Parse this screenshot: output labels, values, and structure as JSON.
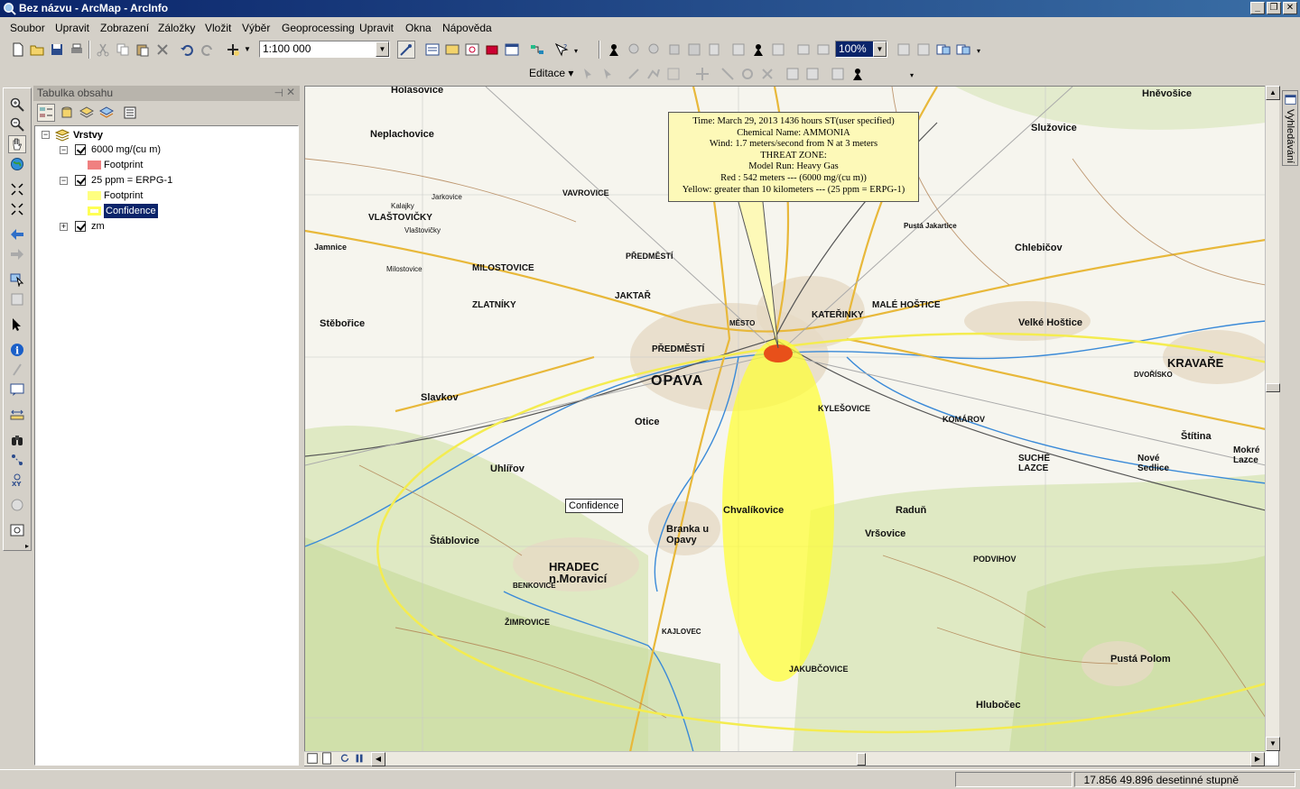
{
  "window": {
    "title": "Bez názvu - ArcMap - ArcInfo"
  },
  "menu": {
    "items": [
      "Soubor",
      "Upravit",
      "Zobrazení",
      "Záložky",
      "Vložit",
      "Výběr",
      "Geoprocessing",
      "Upravit",
      "Okna",
      "Nápověda"
    ]
  },
  "toolbar": {
    "scale_value": "1:100 000",
    "zoom_value": "100%",
    "editor_label": "Editace ▾"
  },
  "toc": {
    "title": "Tabulka obsahu",
    "root": "Vrstvy",
    "layers": [
      {
        "name": "6000 mg/(cu m)",
        "child": "Footprint",
        "color": "#f08080"
      },
      {
        "name": "25 ppm = ERPG-1",
        "children": [
          "Footprint",
          "Confidence"
        ],
        "colors": [
          "#ffff80",
          "#ffff66"
        ]
      },
      {
        "name": "zm"
      }
    ]
  },
  "map": {
    "callout_lines": [
      "Time: March 29, 2013  1436 hours ST(user specified)",
      "Chemical Name: AMMONIA",
      "Wind: 1.7 meters/second from N at 3 meters",
      "THREAT ZONE:",
      "Model Run: Heavy Gas",
      "Red   : 542 meters --- (6000 mg/(cu m))",
      "Yellow: greater than 10 kilometers --- (25 ppm = ERPG-1)"
    ],
    "confidence_label": "Confidence",
    "place_labels": [
      "Holasovice",
      "Neplachovice",
      "VAVROVICE",
      "Jamnice",
      "VLAŠTOVIČKY",
      "MILOSTOVICE",
      "PŘEDMĚSTÍ",
      "ZLATNÍKY",
      "JAKTAŘ",
      "MĚSTO",
      "PŘEDMĚSTÍ",
      "OPAVA",
      "Stěbořice",
      "Slavkov",
      "Otice",
      "KATEŘINKY",
      "MALÉ HOŠTICE",
      "Velké Hoštice",
      "KYLEŠOVICE",
      "KOMÁROV",
      "KRAVAŘE",
      "Chlebičov",
      "Služovice",
      "Hněvošice",
      "Uhlířov",
      "Štáblovice",
      "Branka u Opavy",
      "HRADEC n.Moravicí",
      "Chvalíkovice",
      "Raduň",
      "Vršovice",
      "SUCHÉ LAZCE",
      "Nové Sedlice",
      "Štítina",
      "Mokré Lazce",
      "PODVIHOV",
      "Pustá Polom",
      "Hlubočec",
      "JAKUBČOVICE",
      "ŽIMROVICE",
      "BENKOVICE",
      "KAJLOVEC",
      "Jarkovice",
      "Kalajky",
      "Milostovice",
      "Vlaštovičky",
      "Pustá Jakartice",
      "DVOŘÍSKO"
    ],
    "accent_red": "#e8501a",
    "accent_yellow": "#ffff33"
  },
  "side_tab": "Vyhledávání",
  "status": {
    "coordinates": "17.856  49.896 desetinné stupně"
  }
}
